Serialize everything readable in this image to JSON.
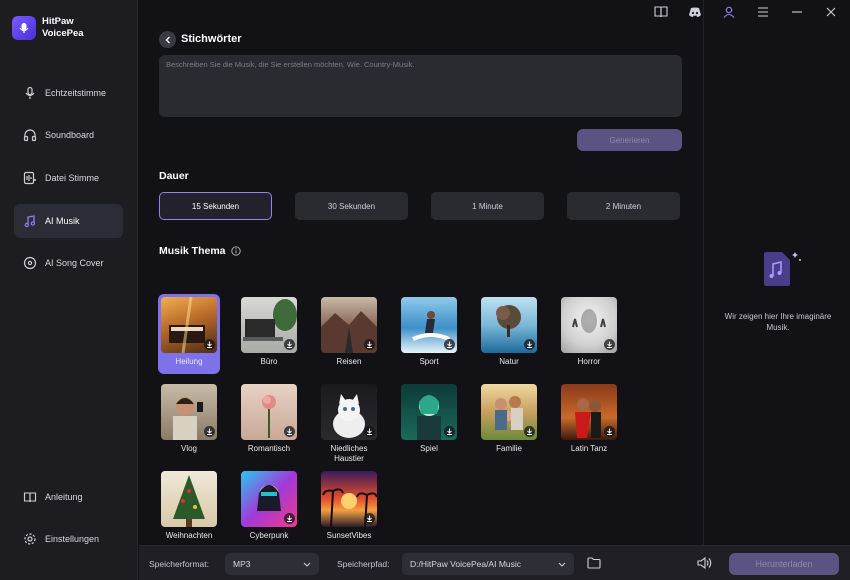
{
  "app": {
    "name_line1": "HitPaw",
    "name_line2": "VoicePea"
  },
  "sidebar": {
    "items": [
      {
        "label": "Echtzeitstimme",
        "icon": "microphone-icon"
      },
      {
        "label": "Soundboard",
        "icon": "headphones-icon"
      },
      {
        "label": "Datei Stimme",
        "icon": "file-voice-icon"
      },
      {
        "label": "AI Musik",
        "icon": "music-note-icon",
        "active": true
      },
      {
        "label": "AI Song Cover",
        "icon": "disc-icon"
      }
    ],
    "bottom": [
      {
        "label": "Anleitung",
        "icon": "book-icon"
      },
      {
        "label": "Einstellungen",
        "icon": "gear-icon"
      }
    ]
  },
  "main": {
    "title": "Stichwörter",
    "textarea_placeholder": "Beschreiben Sie die Musik, die Sie erstellen möchten. Wie. Country-Musik.",
    "generate_label": "Generieren",
    "duration_title": "Dauer",
    "durations": [
      "15 Sekunden",
      "30 Sekunden",
      "1 Minute",
      "2 Minuten"
    ],
    "selected_duration": "15 Sekunden",
    "theme_title": "Musik Thema",
    "themes": [
      "Heilung",
      "Büro",
      "Reisen",
      "Sport",
      "Natur",
      "Horror",
      "Vlog",
      "Romantisch",
      "Niedliches Haustier",
      "Spiel",
      "Familie",
      "Latin Tanz",
      "Weihnachten",
      "Cyberpunk",
      "SunsetVibes"
    ],
    "selected_theme": "Heilung"
  },
  "right_panel": {
    "empty_text": "Wir zeigen hier Ihre imaginäre Musik."
  },
  "bottom_bar": {
    "format_label": "Speicherformat:",
    "format_value": "MP3",
    "path_label": "Speicherpfad:",
    "path_value": "D:/HitPaw VoicePea/AI Music",
    "download_label": "Herunterladen"
  },
  "colors": {
    "accent": "#7d72e8",
    "disabled_button": "#5b5482"
  }
}
